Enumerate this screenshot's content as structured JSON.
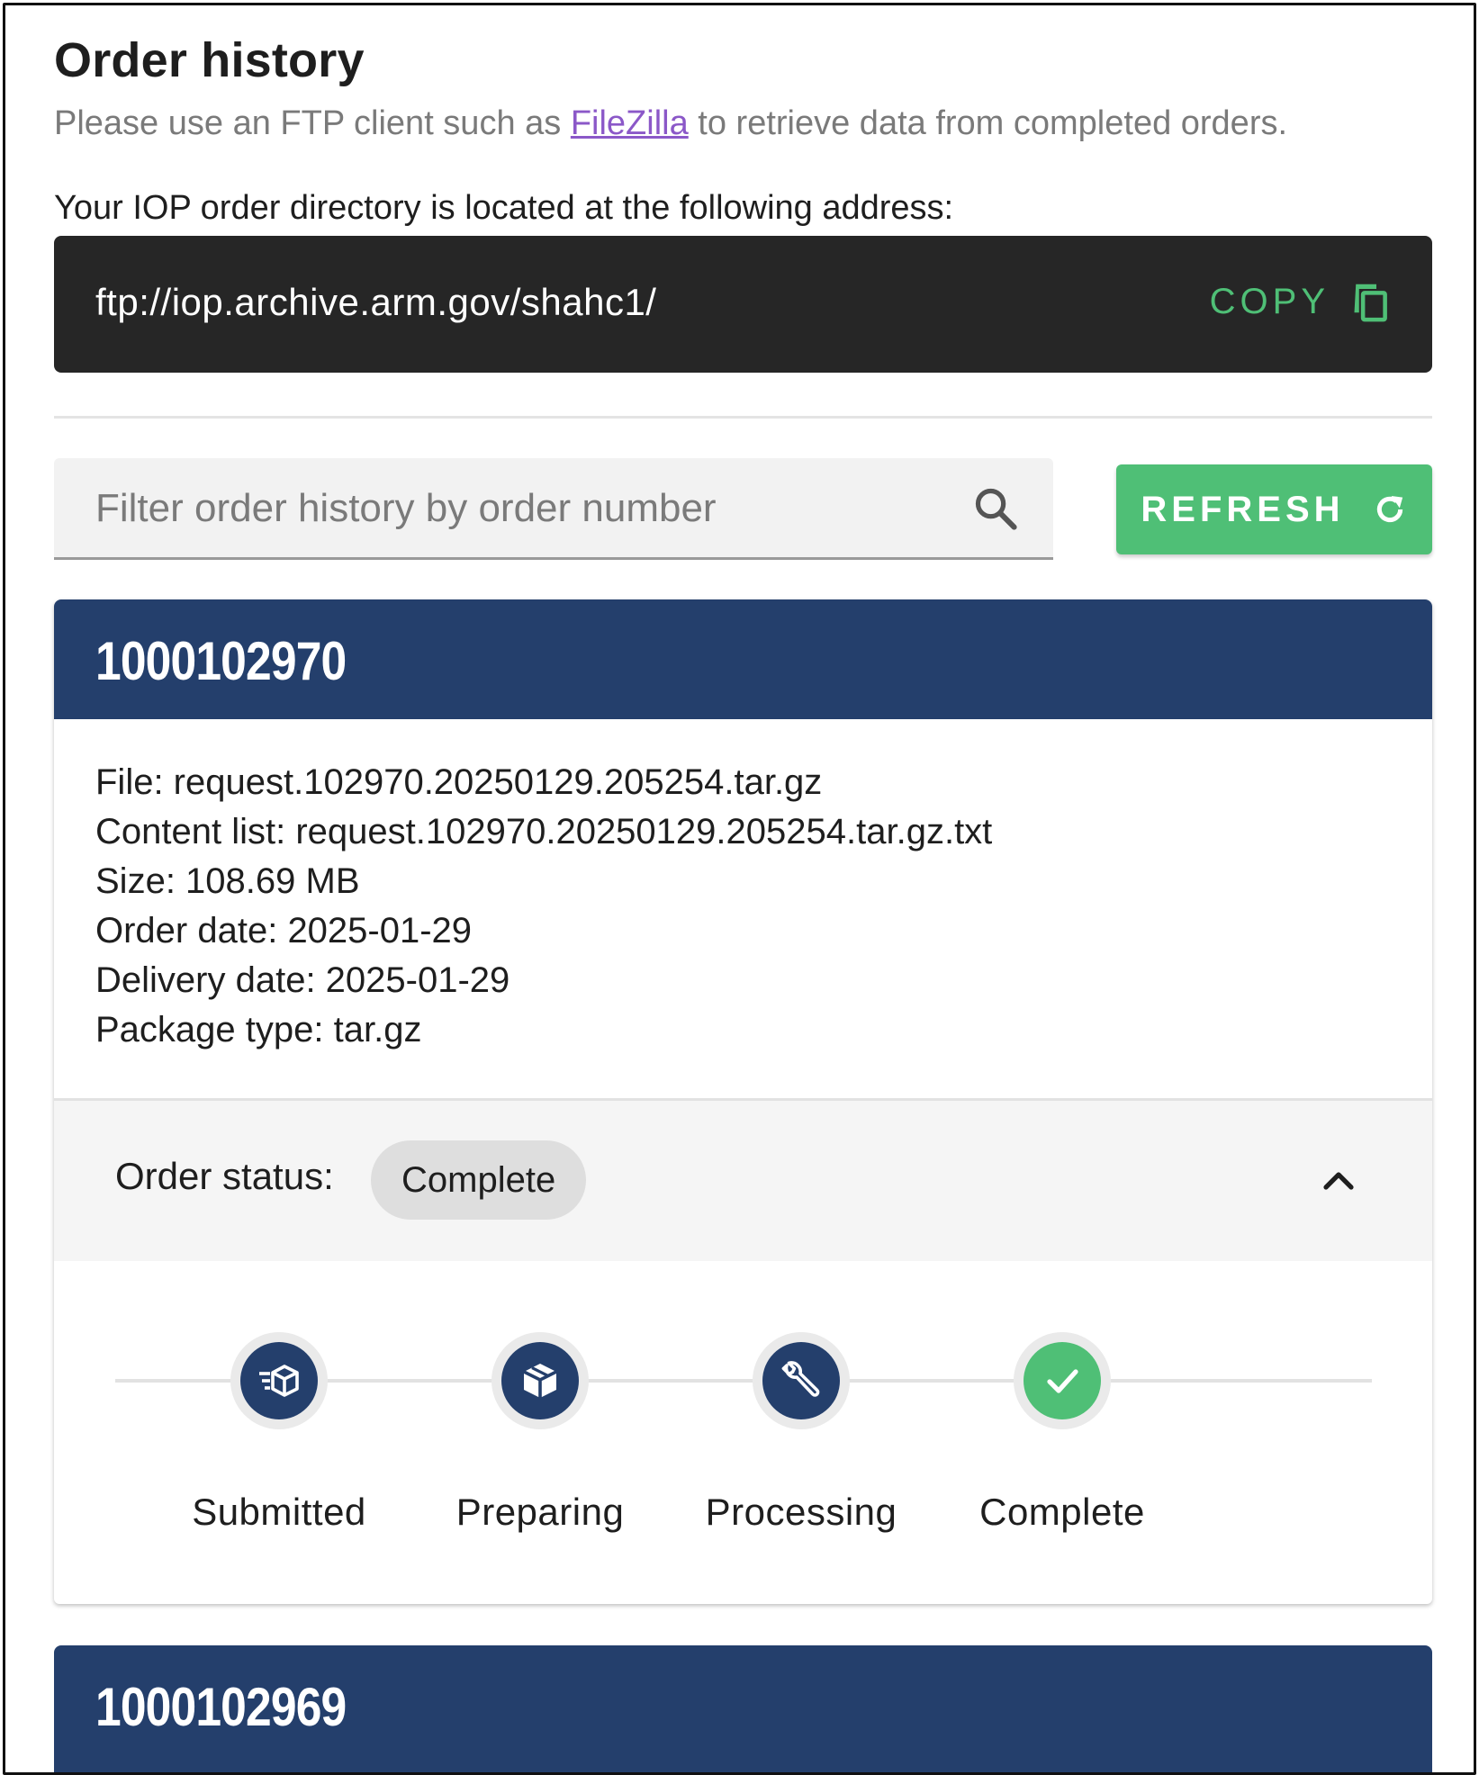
{
  "page": {
    "title": "Order history",
    "subtitle_before": "Please use an FTP client such as ",
    "subtitle_link": "FileZilla",
    "subtitle_after": " to retrieve data from completed orders.",
    "directory_label": "Your IOP order directory is located at the following address:"
  },
  "ftp": {
    "url": "ftp://iop.archive.arm.gov/shahc1/",
    "copy_label": "COPY",
    "copy_icon": "copy-icon"
  },
  "filter": {
    "placeholder": "Filter order history by order number",
    "value": "",
    "search_icon": "search-icon"
  },
  "refresh": {
    "label": "REFRESH",
    "icon": "refresh-icon"
  },
  "orders": [
    {
      "number": "1000102970",
      "file": "File: request.102970.20250129.205254.tar.gz",
      "content_list": "Content list: request.102970.20250129.205254.tar.gz.txt",
      "size": "Size: 108.69 MB",
      "order_date": "Order date: 2025-01-29",
      "delivery_date": "Delivery date: 2025-01-29",
      "package_type": "Package type: tar.gz",
      "status_label": "Order status:",
      "status_value": "Complete",
      "expanded": true,
      "steps": [
        {
          "label": "Submitted",
          "icon": "shipping-box-icon",
          "state": "done"
        },
        {
          "label": "Preparing",
          "icon": "package-icon",
          "state": "done"
        },
        {
          "label": "Processing",
          "icon": "wrench-icon",
          "state": "done"
        },
        {
          "label": "Complete",
          "icon": "check-icon",
          "state": "current-complete"
        }
      ]
    },
    {
      "number": "1000102969"
    }
  ],
  "colors": {
    "navy": "#243f6c",
    "green": "#4fbf76",
    "dark_box": "#262626",
    "link": "#8b58c8",
    "muted_text": "#7a7a7a"
  }
}
